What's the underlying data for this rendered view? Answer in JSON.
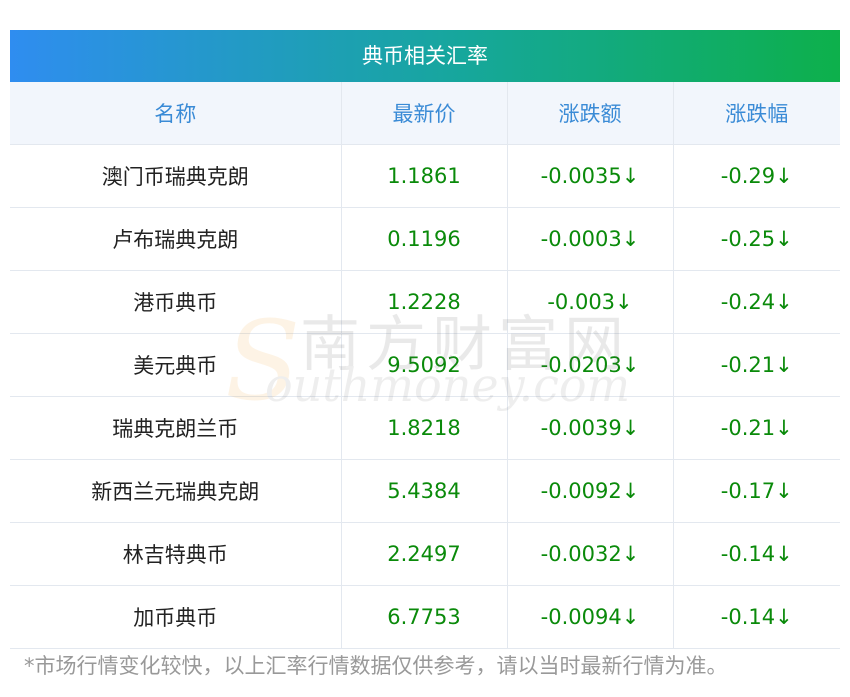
{
  "title": "典币相关汇率",
  "headers": [
    "名称",
    "最新价",
    "涨跌额",
    "涨跌幅"
  ],
  "rows": [
    {
      "name": "澳门币瑞典克朗",
      "price": "1.1861",
      "change": "-0.0035↓",
      "pct": "-0.29↓"
    },
    {
      "name": "卢布瑞典克朗",
      "price": "0.1196",
      "change": "-0.0003↓",
      "pct": "-0.25↓"
    },
    {
      "name": "港币典币",
      "price": "1.2228",
      "change": "-0.003↓",
      "pct": "-0.24↓"
    },
    {
      "name": "美元典币",
      "price": "9.5092",
      "change": "-0.0203↓",
      "pct": "-0.21↓"
    },
    {
      "name": "瑞典克朗兰币",
      "price": "1.8218",
      "change": "-0.0039↓",
      "pct": "-0.21↓"
    },
    {
      "name": "新西兰元瑞典克朗",
      "price": "5.4384",
      "change": "-0.0092↓",
      "pct": "-0.17↓"
    },
    {
      "name": "林吉特典币",
      "price": "2.2497",
      "change": "-0.0032↓",
      "pct": "-0.14↓"
    },
    {
      "name": "加币典币",
      "price": "6.7753",
      "change": "-0.0094↓",
      "pct": "-0.14↓"
    }
  ],
  "watermark": {
    "cn": "南方财富网",
    "en": "outhmoney.com",
    "logo": "S"
  },
  "footnote": "*市场行情变化较快，以上汇率行情数据仅供参考，请以当时最新行情为准。",
  "colors": {
    "header_text": "#3a8bd6",
    "value_text": "#0a8a0a",
    "banner_start": "#2f8df0",
    "banner_end": "#0db04b"
  }
}
